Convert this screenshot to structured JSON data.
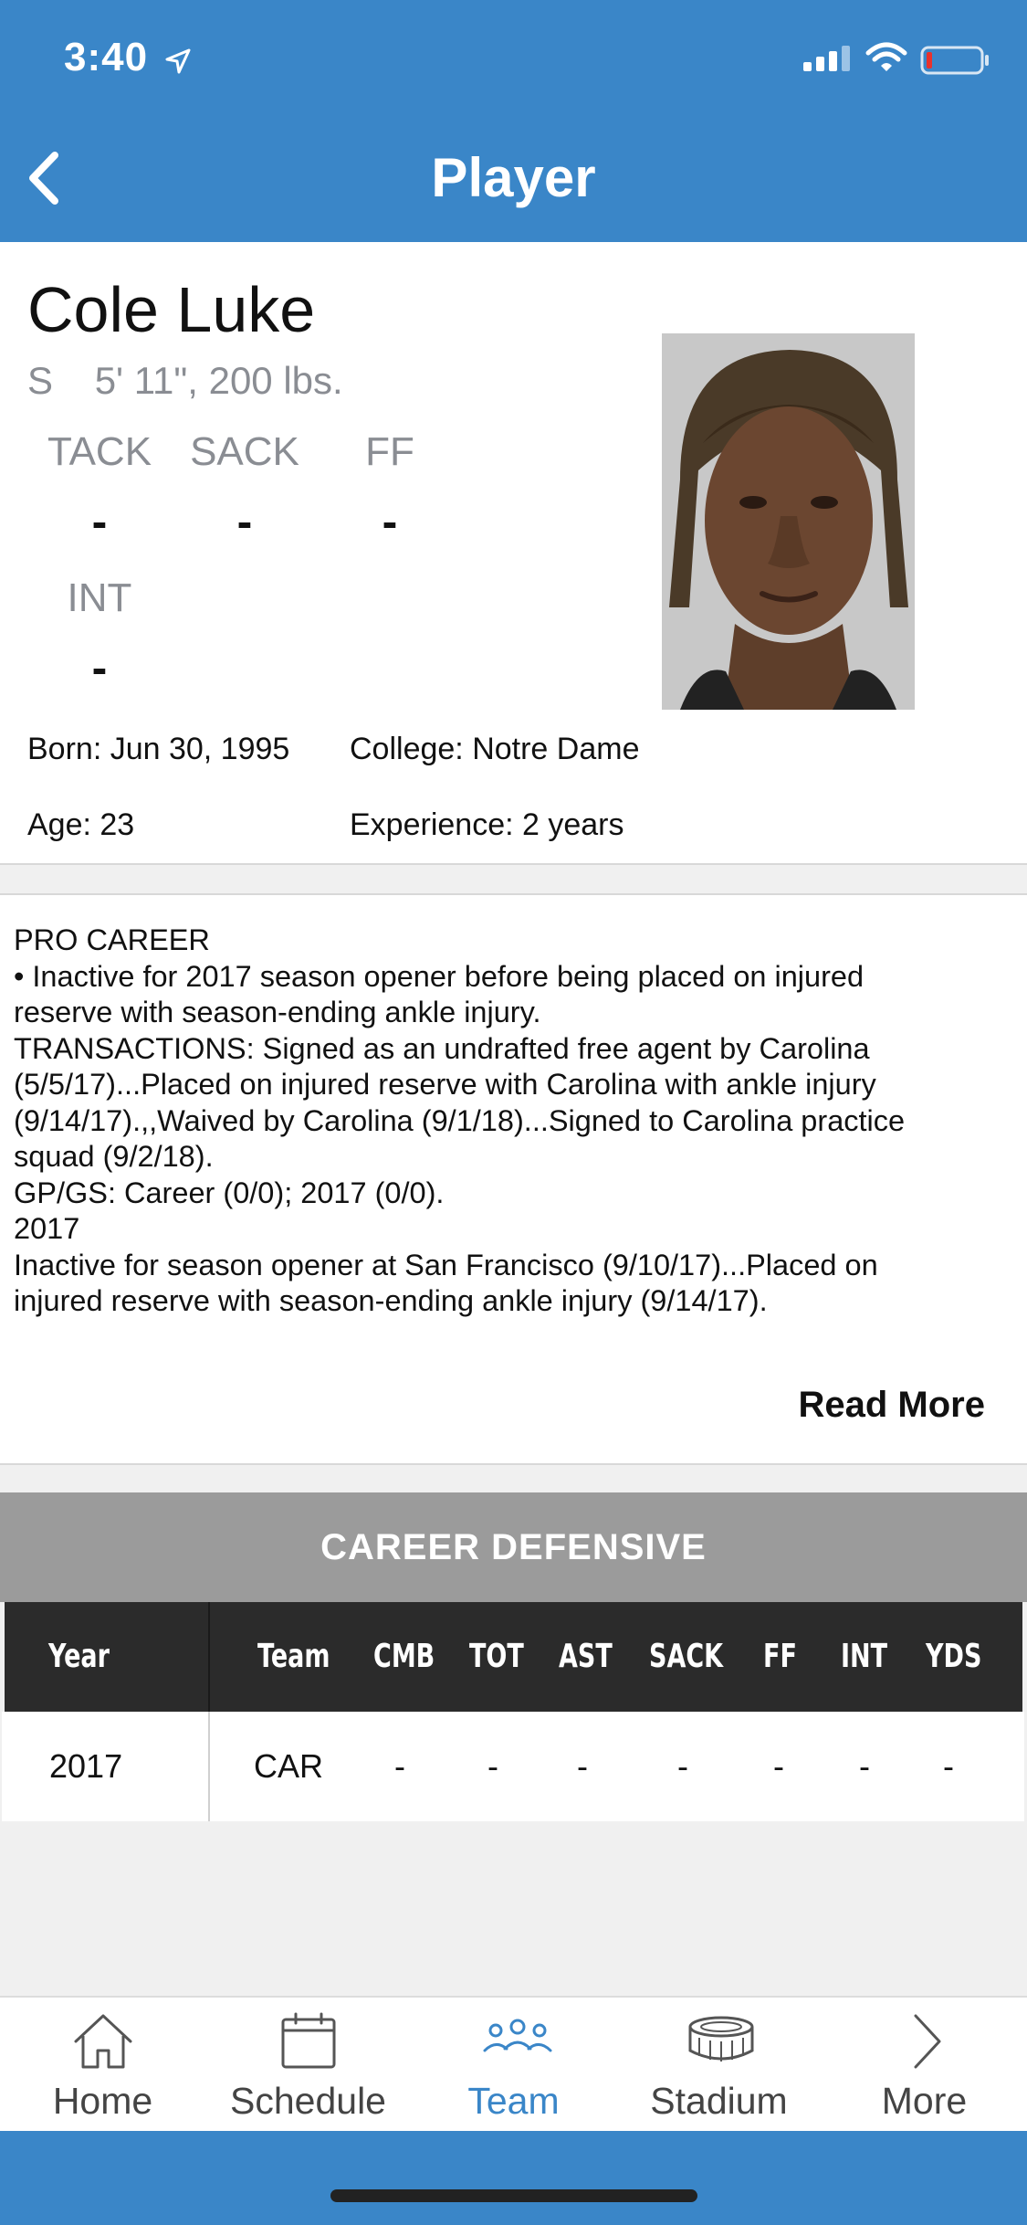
{
  "status_bar": {
    "time": "3:40"
  },
  "nav": {
    "title": "Player"
  },
  "player": {
    "name": "Cole Luke",
    "position": "S",
    "size": "5' 11\", 200 lbs.",
    "stats": [
      {
        "label": "TACK",
        "value": "-"
      },
      {
        "label": "SACK",
        "value": "-"
      },
      {
        "label": "FF",
        "value": "-"
      },
      {
        "label": "INT",
        "value": "-"
      }
    ]
  },
  "bio": {
    "born": "Born: Jun 30, 1995",
    "college": "College: Notre Dame",
    "age": "Age: 23",
    "experience": "Experience: 2 years"
  },
  "career_notes": {
    "lines": [
      "PRO CAREER",
      "• Inactive for 2017 season opener before being placed on injured",
      "reserve with season-ending ankle injury.",
      "TRANSACTIONS: Signed as an undrafted free agent by Carolina",
      "(5/5/17)...Placed on injured reserve with Carolina with ankle injury",
      "(9/14/17).,,Waived by Carolina (9/1/18)...Signed to Carolina practice",
      "squad (9/2/18).",
      "GP/GS: Career (0/0); 2017 (0/0).",
      "2017",
      "Inactive for season opener at San Francisco (9/10/17)...Placed on",
      "injured reserve with season-ending ankle injury (9/14/17)."
    ],
    "read_more": "Read More"
  },
  "career_defensive": {
    "title": "CAREER DEFENSIVE",
    "columns": [
      "Year",
      "Team",
      "CMB",
      "TOT",
      "AST",
      "SACK",
      "FF",
      "INT",
      "YDS"
    ],
    "rows": [
      [
        "2017",
        "CAR",
        "-",
        "-",
        "-",
        "-",
        "-",
        "-",
        "-"
      ]
    ]
  },
  "tabs": [
    {
      "label": "Home",
      "icon": "house-icon",
      "active": false
    },
    {
      "label": "Schedule",
      "icon": "calendar-icon",
      "active": false
    },
    {
      "label": "Team",
      "icon": "people-icon",
      "active": true
    },
    {
      "label": "Stadium",
      "icon": "stadium-icon",
      "active": false
    },
    {
      "label": "More",
      "icon": "chevron-right-icon",
      "active": false
    }
  ],
  "colors": {
    "brand_blue": "#3a86c8",
    "table_header": "#2b2b2b",
    "section_gray": "#9b9b9b"
  }
}
